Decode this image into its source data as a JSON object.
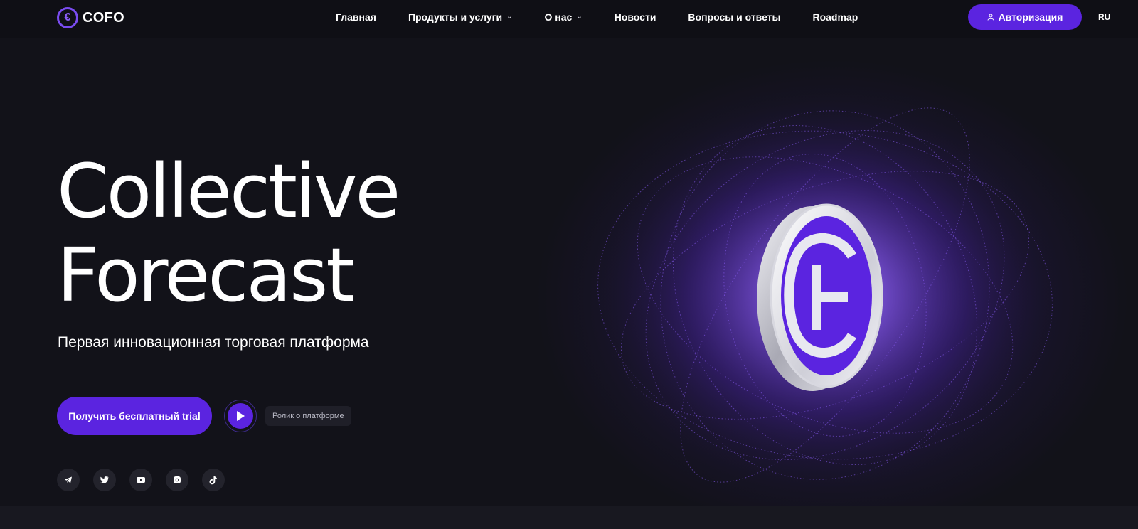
{
  "header": {
    "logo_text": "COFO",
    "nav": [
      {
        "label": "Главная",
        "has_dropdown": false
      },
      {
        "label": "Продукты и услуги",
        "has_dropdown": true
      },
      {
        "label": "О нас",
        "has_dropdown": true
      },
      {
        "label": "Новости",
        "has_dropdown": false
      },
      {
        "label": "Вопросы и ответы",
        "has_dropdown": false
      },
      {
        "label": "Roadmap",
        "has_dropdown": false
      }
    ],
    "auth_label": "Авторизация",
    "lang": "RU"
  },
  "hero": {
    "title_line1": "Collective",
    "title_line2": "Forecast",
    "subtitle": "Первая инновационная торговая платформа",
    "trial_button": "Получить бесплатный trial",
    "video_label": "Ролик о платформе"
  },
  "socials": [
    "telegram-icon",
    "twitter-icon",
    "youtube-icon",
    "instagram-icon",
    "tiktok-icon"
  ],
  "colors": {
    "accent": "#5b24e0",
    "background": "#121219",
    "glow": "#7a4cf0"
  }
}
